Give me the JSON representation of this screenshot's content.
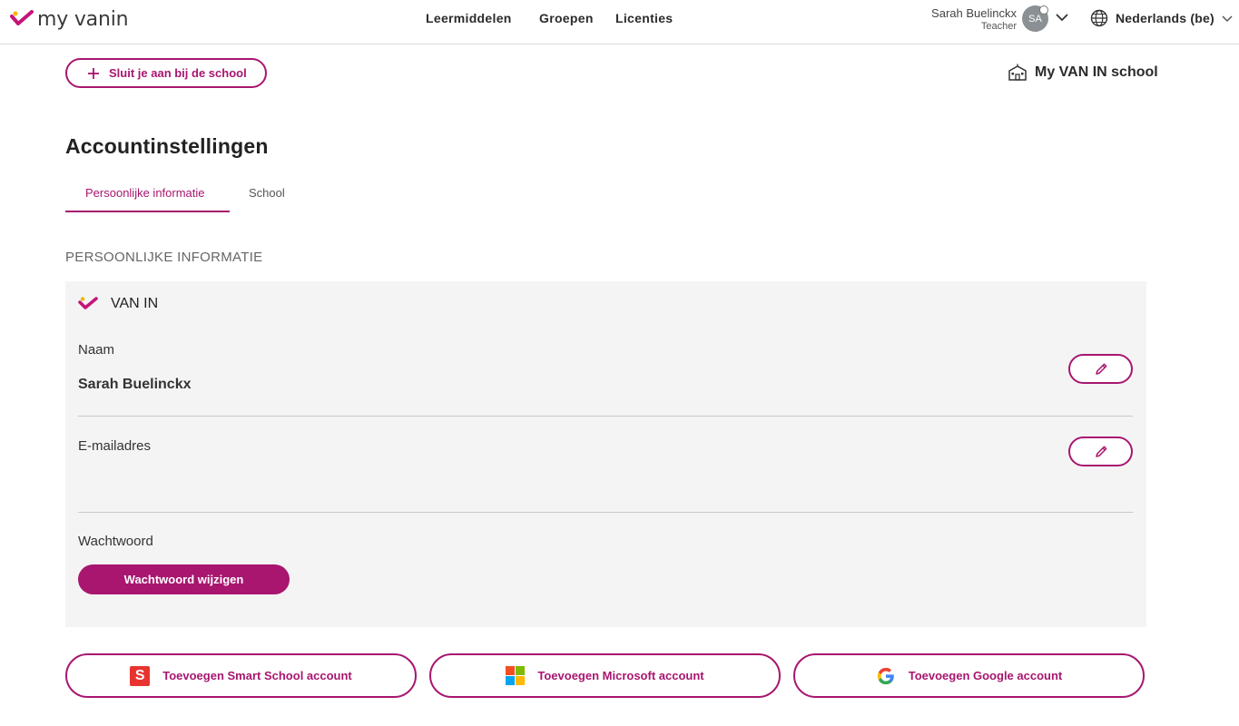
{
  "header": {
    "logo_text": "my vanin",
    "nav": [
      "Leermiddelen",
      "Groepen",
      "Licenties"
    ],
    "user_name": "Sarah Buelinckx",
    "user_role": "Teacher",
    "avatar_initials": "SA",
    "language": "Nederlands (be)"
  },
  "toolbar": {
    "join_school_label": "Sluit je aan bij de school",
    "my_school_label": "My VAN IN school"
  },
  "page": {
    "title": "Accountinstellingen",
    "tabs": [
      {
        "label": "Persoonlijke informatie",
        "active": true
      },
      {
        "label": "School",
        "active": false
      }
    ]
  },
  "personal": {
    "section_title": "PERSOONLIJKE INFORMATIE",
    "provider": "VAN IN",
    "name_label": "Naam",
    "name_value": "Sarah Buelinckx",
    "email_label": "E-mailadres",
    "email_value": "",
    "password_label": "Wachtwoord",
    "change_password_label": "Wachtwoord wijzigen"
  },
  "accounts": [
    {
      "label": "Toevoegen Smart School account",
      "icon": "smartschool-icon"
    },
    {
      "label": "Toevoegen Microsoft account",
      "icon": "microsoft-icon"
    },
    {
      "label": "Toevoegen Google account",
      "icon": "google-icon"
    }
  ],
  "colors": {
    "accent": "#a8166f",
    "card_bg": "#f4f4f4",
    "logo_yellow": "#f5b400"
  }
}
